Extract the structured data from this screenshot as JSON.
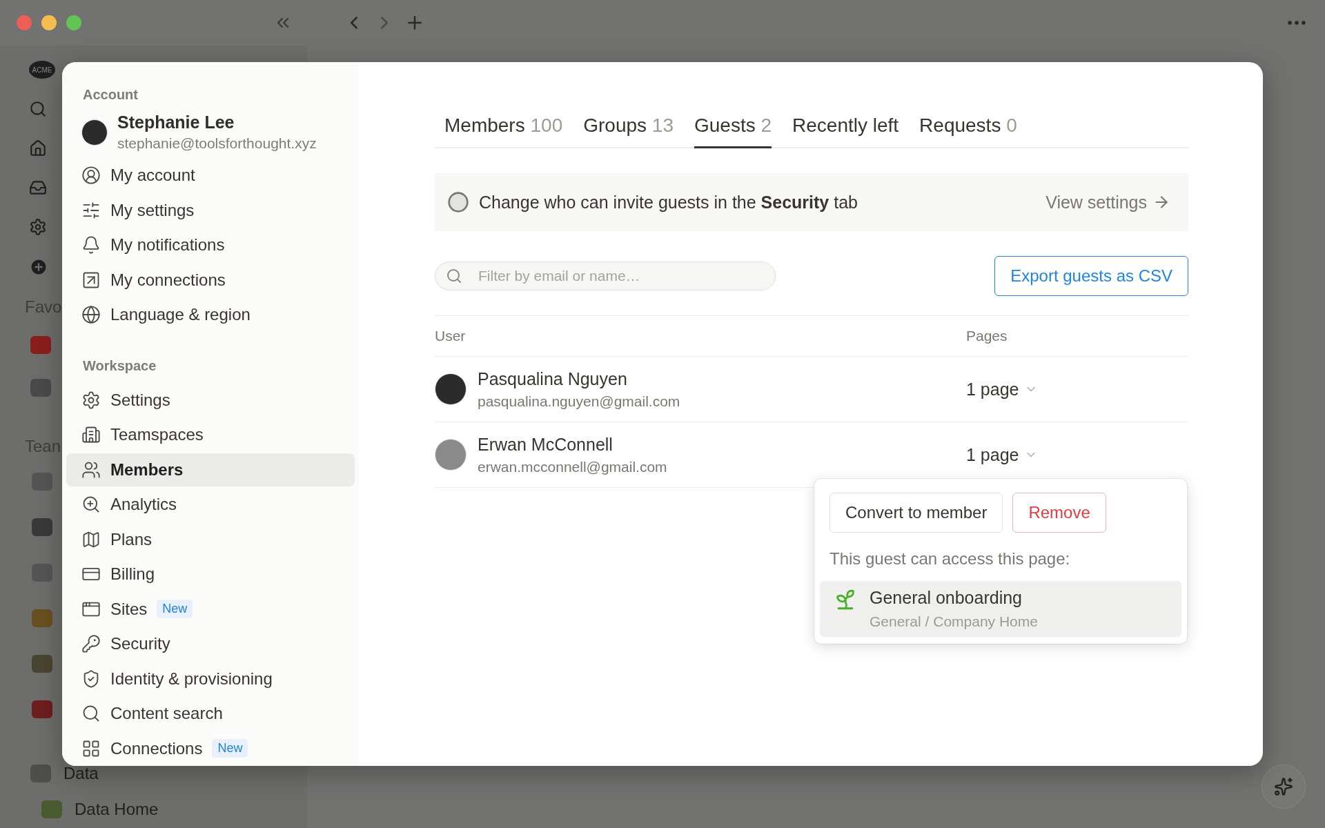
{
  "background": {
    "logo": "ACME",
    "sidebar_items": [
      {
        "label": "Favo"
      },
      {
        "label": "Tean"
      },
      {
        "label": "Data"
      },
      {
        "label": "Data Home"
      }
    ]
  },
  "settings_sidebar": {
    "sections": [
      {
        "title": "Account",
        "profile": {
          "name": "Stephanie Lee",
          "email": "stephanie@toolsforthought.xyz"
        },
        "items": [
          {
            "label": "My account",
            "selected": false
          },
          {
            "label": "My settings",
            "selected": false
          },
          {
            "label": "My notifications",
            "selected": false
          },
          {
            "label": "My connections",
            "selected": false
          },
          {
            "label": "Language & region",
            "selected": false
          }
        ]
      },
      {
        "title": "Workspace",
        "items": [
          {
            "label": "Settings",
            "selected": false
          },
          {
            "label": "Teamspaces",
            "selected": false
          },
          {
            "label": "Members",
            "selected": true
          },
          {
            "label": "Analytics",
            "selected": false
          },
          {
            "label": "Plans",
            "selected": false
          },
          {
            "label": "Billing",
            "selected": false
          },
          {
            "label": "Sites",
            "selected": false,
            "badge": "New"
          },
          {
            "label": "Security",
            "selected": false
          },
          {
            "label": "Identity & provisioning",
            "selected": false
          },
          {
            "label": "Content search",
            "selected": false
          },
          {
            "label": "Connections",
            "selected": false,
            "badge": "New"
          }
        ]
      }
    ]
  },
  "tabs": [
    {
      "label": "Members",
      "count": "100",
      "selected": false
    },
    {
      "label": "Groups",
      "count": "13",
      "selected": false
    },
    {
      "label": "Guests",
      "count": "2",
      "selected": true
    },
    {
      "label": "Recently left",
      "selected": false
    },
    {
      "label": "Requests",
      "count": "0",
      "selected": false
    }
  ],
  "banner": {
    "text": "Change who can invite guests in the **Security** tab",
    "link": "View settings"
  },
  "search": {
    "placeholder": "Filter by email or name…"
  },
  "export_button": "Export guests as CSV",
  "table": {
    "columns": [
      "User",
      "Pages"
    ],
    "rows": [
      {
        "name": "Pasqualina Nguyen",
        "email": "pasqualina.nguyen@gmail.com",
        "pages": "1 page"
      },
      {
        "name": "Erwan McConnell",
        "email": "erwan.mcconnell@gmail.com",
        "pages": "1 page"
      }
    ]
  },
  "popover": {
    "buttons": [
      {
        "label": "Convert to member",
        "kind": "default"
      },
      {
        "label": "Remove",
        "kind": "danger"
      }
    ],
    "caption": "This guest can access this page:",
    "pages": [
      {
        "title": "General onboarding",
        "path": "General / Company Home"
      }
    ]
  }
}
